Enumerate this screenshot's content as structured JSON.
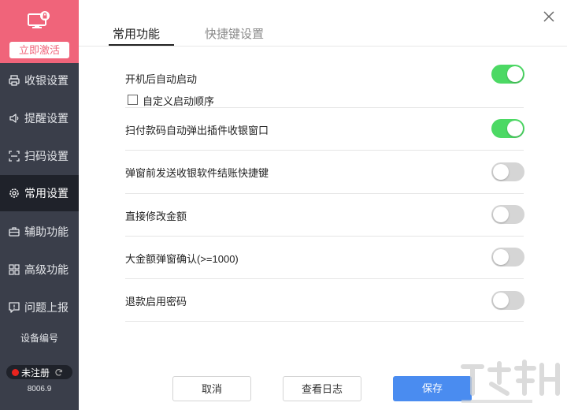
{
  "sidebar": {
    "activate_label": "立即激活",
    "items": [
      {
        "label": "收银设置",
        "icon": "printer-icon",
        "active": false
      },
      {
        "label": "提醒设置",
        "icon": "speaker-icon",
        "active": false
      },
      {
        "label": "扫码设置",
        "icon": "scan-icon",
        "active": false
      },
      {
        "label": "常用设置",
        "icon": "gear-icon",
        "active": true
      },
      {
        "label": "辅助功能",
        "icon": "briefcase-icon",
        "active": false
      },
      {
        "label": "高级功能",
        "icon": "grid-icon",
        "active": false
      },
      {
        "label": "问题上报",
        "icon": "report-icon",
        "active": false
      }
    ],
    "device_label": "设备编号",
    "status": "未注册",
    "version": "8006.9"
  },
  "tabs": [
    {
      "label": "常用功能",
      "active": true
    },
    {
      "label": "快捷键设置",
      "active": false
    }
  ],
  "settings": [
    {
      "label": "开机后自动启动",
      "on": true
    },
    {
      "label": "扫付款码自动弹出插件收银窗口",
      "on": true
    },
    {
      "label": "弹窗前发送收银软件结账快捷键",
      "on": false
    },
    {
      "label": "直接修改金额",
      "on": false
    },
    {
      "label": "大金额弹窗确认(>=1000)",
      "on": false
    },
    {
      "label": "退款启用密码",
      "on": false
    }
  ],
  "checkbox": {
    "label": "自定义启动顺序",
    "checked": false
  },
  "buttons": {
    "cancel": "取消",
    "log": "查看日志",
    "save": "保存"
  },
  "colors": {
    "brand": "#f0647a",
    "sidebar_bg": "#3a3e4a",
    "active_nav": "#1f222a",
    "toggle_on": "#4cd964",
    "save_button": "#4a8cf0"
  }
}
